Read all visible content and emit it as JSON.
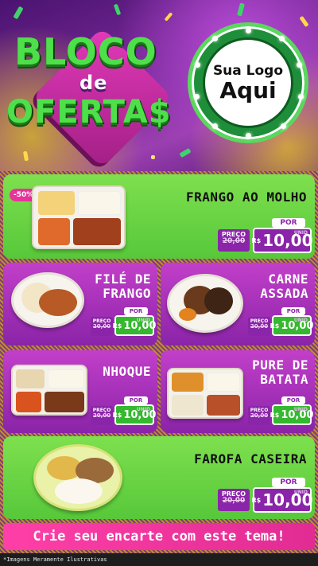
{
  "header": {
    "title_line1": "BLOCO",
    "title_line2": "de",
    "title_line3": "OFERTA$",
    "logo_line1": "Sua Logo",
    "logo_line2": "Aqui"
  },
  "products": [
    {
      "name": "FRANGO AO MOLHO",
      "discount": "-50%",
      "por_label": "POR",
      "preco_label": "PREÇO",
      "old_price": "20,00",
      "currency": "R$",
      "price": "10,00",
      "unit": "UNID"
    },
    {
      "name": "FILÉ DE FRANGO",
      "por_label": "POR",
      "preco_label": "PREÇO",
      "old_price": "20,00",
      "currency": "R$",
      "price": "10,00",
      "unit": "UNID"
    },
    {
      "name": "CARNE ASSADA",
      "por_label": "POR",
      "preco_label": "PREÇO",
      "old_price": "20,00",
      "currency": "R$",
      "price": "10,00",
      "unit": "UNID"
    },
    {
      "name": "NHOQUE",
      "por_label": "POR",
      "preco_label": "PREÇO",
      "old_price": "20,00",
      "currency": "R$",
      "price": "10,00",
      "unit": "UNID"
    },
    {
      "name": "PURE DE BATATA",
      "por_label": "POR",
      "preco_label": "PREÇO",
      "old_price": "20,00",
      "currency": "R$",
      "price": "10,00",
      "unit": "UNID"
    },
    {
      "name": "FAROFA CASEIRA",
      "por_label": "POR",
      "preco_label": "PREÇO",
      "old_price": "20,00",
      "currency": "R$",
      "price": "10,00",
      "unit": "UNID"
    }
  ],
  "cta": "Crie seu encarte com este tema!",
  "footer": "*Imagens Meramente Ilustrativas",
  "colors": {
    "accent_green": "#57c83a",
    "accent_purple": "#8a24a8",
    "cta_pink": "#e12c93"
  }
}
